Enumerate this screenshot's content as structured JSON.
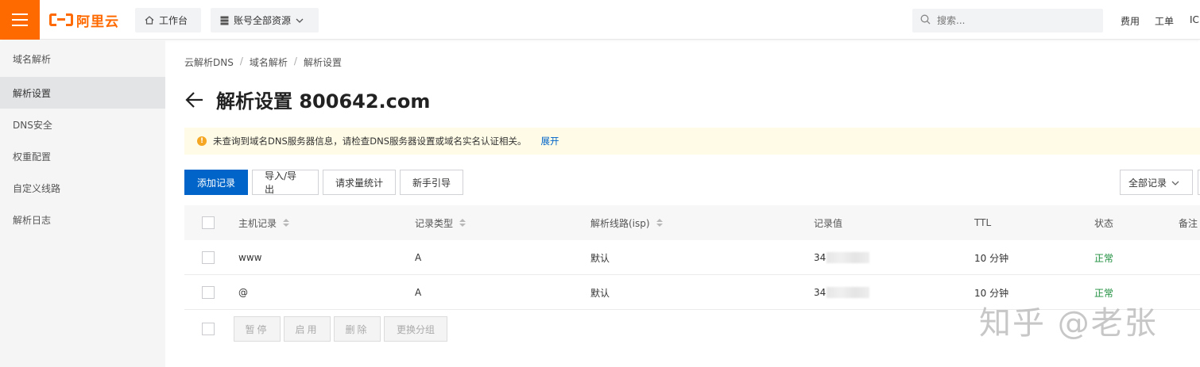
{
  "topbar": {
    "logo_text": "阿里云",
    "workbench_label": "工作台",
    "resources_label": "账号全部资源",
    "search_placeholder": "搜索...",
    "links": [
      "费用",
      "工单",
      "IC"
    ],
    "brand_color": "#ff6a00"
  },
  "sidebar": {
    "header": "域名解析",
    "items": [
      {
        "label": "解析设置",
        "active": true
      },
      {
        "label": "DNS安全",
        "active": false
      },
      {
        "label": "权重配置",
        "active": false
      },
      {
        "label": "自定义线路",
        "active": false
      },
      {
        "label": "解析日志",
        "active": false
      }
    ]
  },
  "breadcrumb": [
    "云解析DNS",
    "域名解析",
    "解析设置"
  ],
  "page_title": "解析设置 800642.com",
  "notice": {
    "text": "未查询到域名DNS服务器信息，请检查DNS服务器设置或域名实名认证相关。",
    "expand_label": "展开"
  },
  "toolbar": {
    "add_record": "添加记录",
    "import_export": "导入/导出",
    "request_stats": "请求量统计",
    "beginner_guide": "新手引导",
    "filter_label": "全部记录",
    "accent_color": "#0064c8"
  },
  "table": {
    "columns": [
      "主机记录",
      "记录类型",
      "解析线路(isp)",
      "记录值",
      "TTL",
      "状态",
      "备注"
    ],
    "rows": [
      {
        "host": "www",
        "type": "A",
        "line": "默认",
        "value": "34",
        "ttl": "10 分钟",
        "status": "正常"
      },
      {
        "host": "@",
        "type": "A",
        "line": "默认",
        "value": "34",
        "ttl": "10 分钟",
        "status": "正常"
      }
    ]
  },
  "bulk_actions": {
    "pause": "暂停",
    "enable": "启用",
    "delete": "删除",
    "change_group": "更换分组"
  },
  "watermark": "知乎 @老张"
}
